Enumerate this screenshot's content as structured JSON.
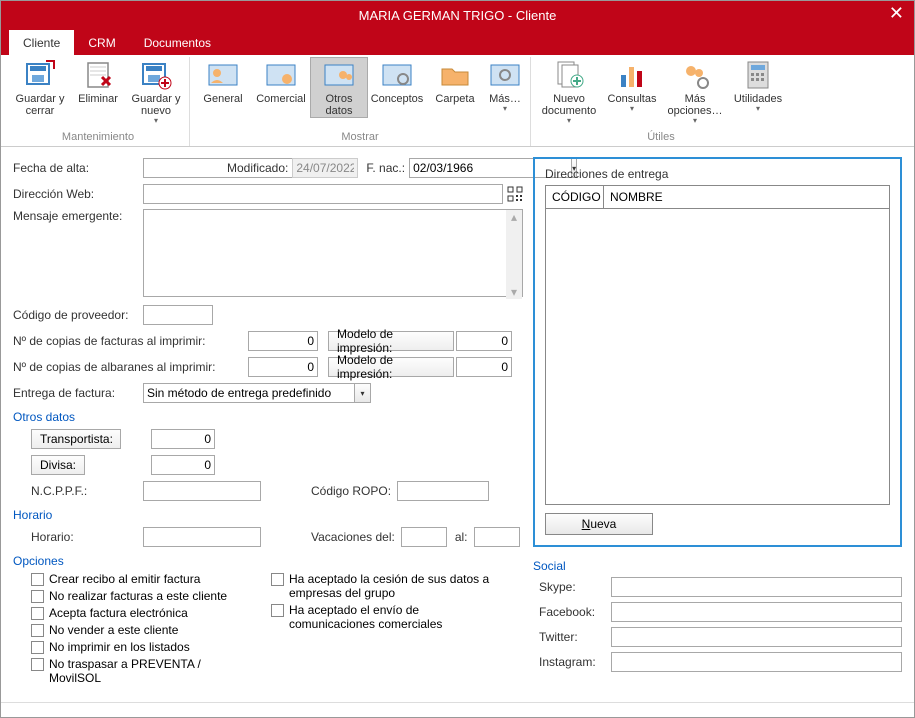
{
  "window": {
    "title": "MARIA GERMAN TRIGO - Cliente"
  },
  "tabs": {
    "cliente": "Cliente",
    "crm": "CRM",
    "documentos": "Documentos"
  },
  "ribbon": {
    "mantenimiento": {
      "guardar_cerrar": "Guardar y cerrar",
      "eliminar": "Eliminar",
      "guardar_nuevo": "Guardar y nuevo",
      "group": "Mantenimiento"
    },
    "mostrar": {
      "general": "General",
      "comercial": "Comercial",
      "otros_datos": "Otros datos",
      "conceptos": "Conceptos",
      "carpeta": "Carpeta",
      "mas": "Más…",
      "group": "Mostrar"
    },
    "utiles": {
      "nuevo_doc": "Nuevo documento",
      "consultas": "Consultas",
      "mas_opciones": "Más opciones…",
      "utilidades": "Utilidades",
      "group": "Útiles"
    }
  },
  "form": {
    "fecha_alta_lbl": "Fecha de alta:",
    "fecha_alta_val": "",
    "modificado_lbl": "Modificado:",
    "modificado_val": "24/07/2022",
    "fnac_lbl": "F. nac.:",
    "fnac_val": "02/03/1966",
    "dir_web_lbl": "Dirección Web:",
    "dir_web_val": "",
    "msg_emerg_lbl": "Mensaje emergente:",
    "msg_emerg_val": "",
    "cod_prov_lbl": "Código de proveedor:",
    "cod_prov_val": "",
    "copias_fact_lbl": "Nº de copias de facturas al imprimir:",
    "copias_fact_val": "0",
    "copias_alb_lbl": "Nº de copias de albaranes al imprimir:",
    "copias_alb_val": "0",
    "modelo_imp": "Modelo de impresión:",
    "modelo_imp_val1": "0",
    "modelo_imp_val2": "0",
    "entrega_fact_lbl": "Entrega de factura:",
    "entrega_fact_val": "Sin método de entrega predefinido",
    "otros_datos_title": "Otros datos",
    "transportista_lbl": "Transportista:",
    "transportista_val": "0",
    "divisa_lbl": "Divisa:",
    "divisa_val": "0",
    "ncppf_lbl": "N.C.P.P.F.:",
    "ncppf_val": "",
    "cod_ropo_lbl": "Código ROPO:",
    "cod_ropo_val": "",
    "horario_title": "Horario",
    "horario_lbl": "Horario:",
    "horario_val": "",
    "vacaciones_lbl": "Vacaciones del:",
    "vacaciones_del": "",
    "vacaciones_al_lbl": "al:",
    "vacaciones_al": "",
    "opciones_title": "Opciones",
    "chk1": "Crear recibo al emitir factura",
    "chk2": "No realizar facturas a este cliente",
    "chk3": "Acepta factura electrónica",
    "chk4": "No vender a este cliente",
    "chk5": "No imprimir en los listados",
    "chk6": "No traspasar a PREVENTA / MovilSOL",
    "chk7": "Ha aceptado la cesión de sus datos a empresas del grupo",
    "chk8": "Ha aceptado el envío de comunicaciones comerciales"
  },
  "delivery": {
    "title": "Direcciones de entrega",
    "col_codigo": "CÓDIGO",
    "col_nombre": "NOMBRE",
    "nueva": "Nueva"
  },
  "social": {
    "title": "Social",
    "skype": "Skype:",
    "facebook": "Facebook:",
    "twitter": "Twitter:",
    "instagram": "Instagram:",
    "skype_val": "",
    "facebook_val": "",
    "twitter_val": "",
    "instagram_val": ""
  }
}
